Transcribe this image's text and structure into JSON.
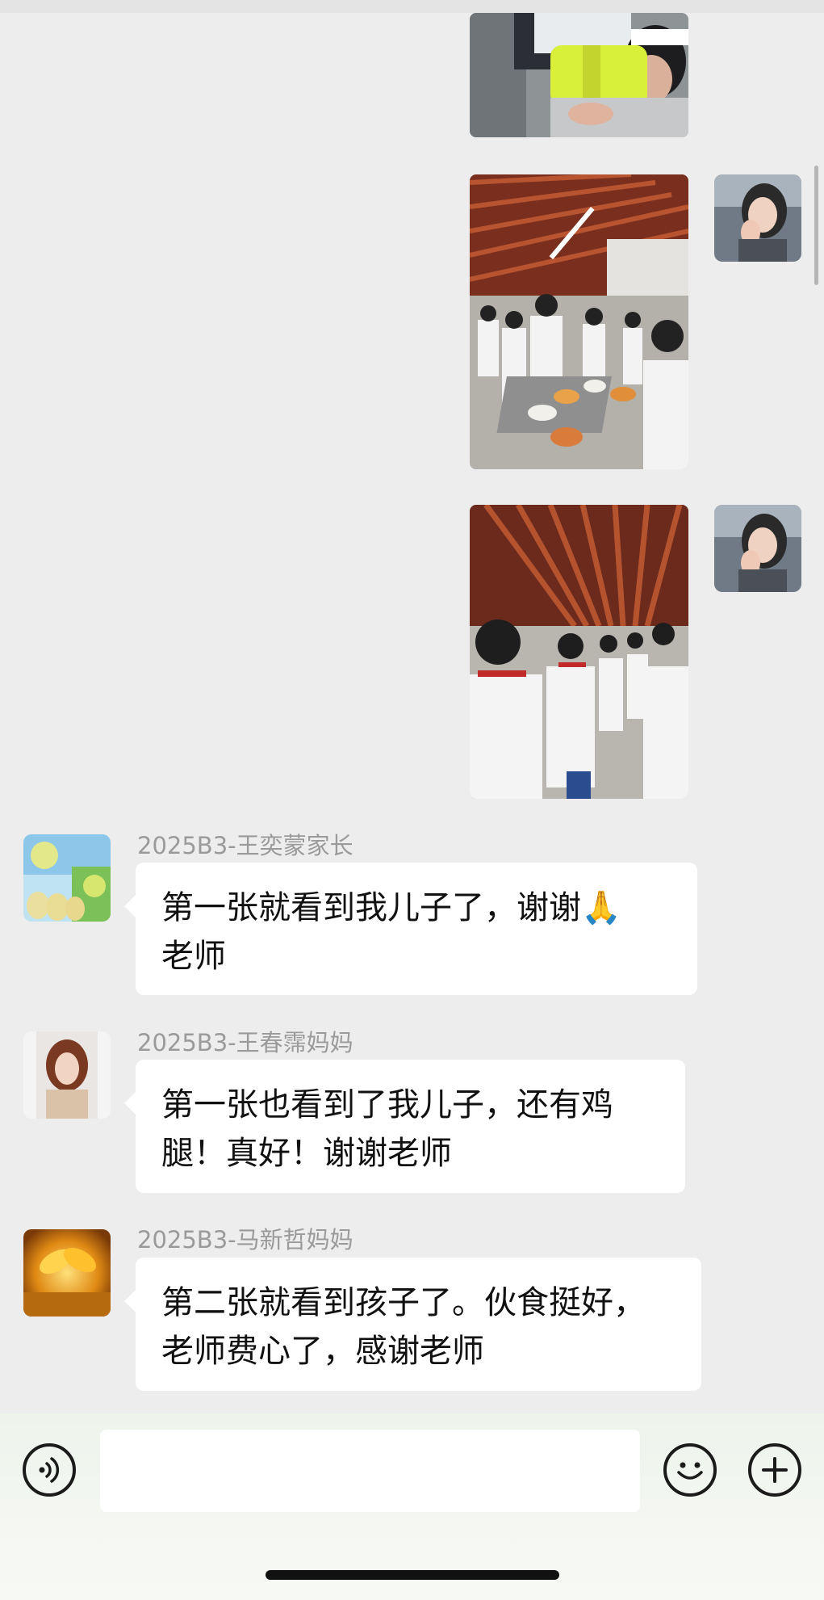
{
  "chat": {
    "own_messages": [
      {
        "type": "image",
        "icon": "photo-students-cafeteria-crop"
      },
      {
        "type": "image",
        "icon": "photo-cafeteria-food-line"
      },
      {
        "type": "image",
        "icon": "photo-cafeteria-students-standing"
      }
    ],
    "own_avatar": "selfie-avatar",
    "messages": [
      {
        "sender": "2025B3-王奕蒙家长",
        "avatar": "pear-fruit-avatar",
        "lines": [
          "第一张就看到我儿子了，谢谢🙏",
          "老师"
        ]
      },
      {
        "sender": "2025B3-王春霈妈妈",
        "avatar": "woman-portrait-avatar",
        "lines": [
          "第一张也看到了我儿子，还有鸡",
          "腿！真好！谢谢老师"
        ]
      },
      {
        "sender": "2025B3-马新哲妈妈",
        "avatar": "golden-fish-avatar",
        "lines": [
          "第二张就看到孩子了。伙食挺好，",
          "老师费心了，感谢老师"
        ]
      }
    ]
  },
  "input_bar": {
    "voice_icon": "voice-icon",
    "message_value": "",
    "emoji_icon": "emoji-icon",
    "plus_icon": "plus-icon"
  },
  "colors": {
    "background": "#ededed",
    "bubble": "#ffffff",
    "sender_text": "#9a9a9a",
    "input_bar": "#f4f7f2"
  }
}
